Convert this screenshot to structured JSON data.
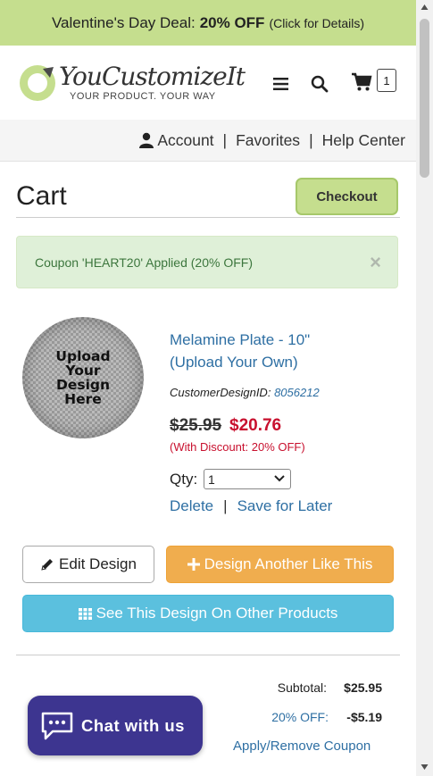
{
  "promo": {
    "prefix": "Valentine's Day Deal:",
    "deal": "20% OFF",
    "details": "(Click for Details)"
  },
  "header": {
    "logo_name": "YouCustomizeIt",
    "logo_tagline": "YOUR PRODUCT. YOUR WAY",
    "cart_count": "1"
  },
  "account_bar": {
    "account": "Account",
    "favorites": "Favorites",
    "help": "Help Center",
    "separator": "|"
  },
  "cart": {
    "title": "Cart",
    "checkout_label": "Checkout"
  },
  "alert": {
    "message": "Coupon 'HEART20' Applied (20% OFF)",
    "close": "×"
  },
  "product": {
    "plate_text": [
      "Upload",
      "Your",
      "Design",
      "Here"
    ],
    "name_line1": "Melamine Plate - 10\"",
    "name_line2": "(Upload Your Own)",
    "design_id_label": "CustomerDesignID:",
    "design_id_value": "8056212",
    "old_price": "$25.95",
    "new_price": "$20.76",
    "discount_note": "(With Discount: 20% OFF)",
    "qty_label": "Qty:",
    "qty_value": "1",
    "delete_label": "Delete",
    "links_separator": "|",
    "save_later_label": "Save for Later"
  },
  "actions": {
    "edit_design": "Edit Design",
    "design_another": "Design Another Like This",
    "see_other": "See This Design On Other Products"
  },
  "totals": {
    "subtotal_label": "Subtotal:",
    "subtotal_value": "$25.95",
    "discount_label": "20% OFF:",
    "discount_value": "-$5.19",
    "coupon_link": "Apply/Remove Coupon"
  },
  "chat": {
    "label": "Chat with us"
  },
  "colors": {
    "promo_bg": "#c5de8e",
    "link": "#2e6fa3",
    "sale_red": "#c8102e",
    "orange_btn": "#f0ad4e",
    "blue_btn": "#5bc0de",
    "chat_bg": "#3d3590"
  }
}
